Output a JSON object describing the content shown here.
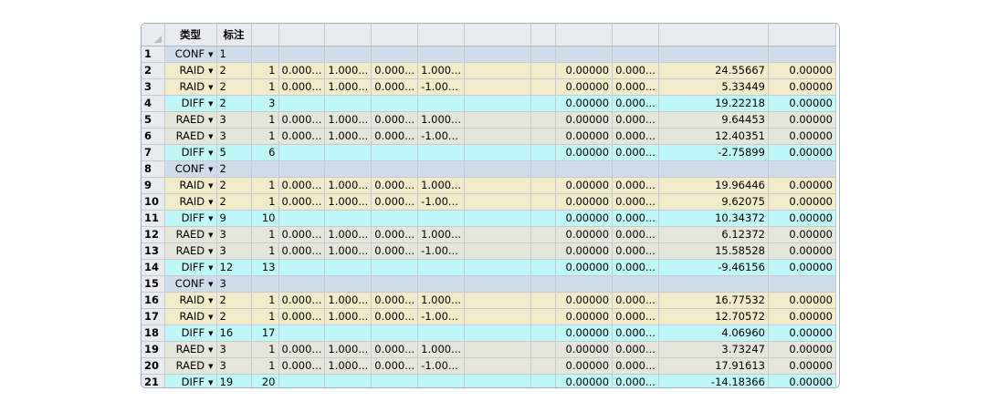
{
  "headers": [
    "",
    "类型",
    "标注",
    "",
    "",
    "",
    "",
    "",
    "",
    "",
    "",
    "",
    "",
    ""
  ],
  "rows": [
    {
      "n": "1",
      "kind": "conf",
      "type": "CONF",
      "mark": "1",
      "c3": "",
      "c4": "",
      "c5": "",
      "c6": "",
      "c7": "",
      "c10": "",
      "c11": "",
      "c12": "",
      "c13": ""
    },
    {
      "n": "2",
      "kind": "raid",
      "type": "RAID",
      "mark": "2",
      "c3": "1",
      "c4": "0.000...",
      "c5": "1.000...",
      "c6": "0.000...",
      "c7": "1.000...",
      "c10": "0.00000",
      "c11": "0.000...",
      "c12": "24.55667",
      "c13": "0.00000"
    },
    {
      "n": "3",
      "kind": "raid",
      "type": "RAID",
      "mark": "2",
      "c3": "1",
      "c4": "0.000...",
      "c5": "1.000...",
      "c6": "0.000...",
      "c7": "-1.00...",
      "c10": "0.00000",
      "c11": "0.000...",
      "c12": "5.33449",
      "c13": "0.00000"
    },
    {
      "n": "4",
      "kind": "diff",
      "type": "DIFF",
      "mark": "2",
      "c3": "3",
      "c4": "",
      "c5": "",
      "c6": "",
      "c7": "",
      "c10": "0.00000",
      "c11": "0.000...",
      "c12": "19.22218",
      "c13": "0.00000"
    },
    {
      "n": "5",
      "kind": "raed",
      "type": "RAED",
      "mark": "3",
      "c3": "1",
      "c4": "0.000...",
      "c5": "1.000...",
      "c6": "0.000...",
      "c7": "1.000...",
      "c10": "0.00000",
      "c11": "0.000...",
      "c12": "9.64453",
      "c13": "0.00000"
    },
    {
      "n": "6",
      "kind": "raed",
      "type": "RAED",
      "mark": "3",
      "c3": "1",
      "c4": "0.000...",
      "c5": "1.000...",
      "c6": "0.000...",
      "c7": "-1.00...",
      "c10": "0.00000",
      "c11": "0.000...",
      "c12": "12.40351",
      "c13": "0.00000"
    },
    {
      "n": "7",
      "kind": "diff",
      "type": "DIFF",
      "mark": "5",
      "c3": "6",
      "c4": "",
      "c5": "",
      "c6": "",
      "c7": "",
      "c10": "0.00000",
      "c11": "0.000...",
      "c12": "-2.75899",
      "c13": "0.00000"
    },
    {
      "n": "8",
      "kind": "conf",
      "type": "CONF",
      "mark": "2",
      "c3": "",
      "c4": "",
      "c5": "",
      "c6": "",
      "c7": "",
      "c10": "",
      "c11": "",
      "c12": "",
      "c13": ""
    },
    {
      "n": "9",
      "kind": "raid",
      "type": "RAID",
      "mark": "2",
      "c3": "1",
      "c4": "0.000...",
      "c5": "1.000...",
      "c6": "0.000...",
      "c7": "1.000...",
      "c10": "0.00000",
      "c11": "0.000...",
      "c12": "19.96446",
      "c13": "0.00000"
    },
    {
      "n": "10",
      "kind": "raid",
      "type": "RAID",
      "mark": "2",
      "c3": "1",
      "c4": "0.000...",
      "c5": "1.000...",
      "c6": "0.000...",
      "c7": "-1.00...",
      "c10": "0.00000",
      "c11": "0.000...",
      "c12": "9.62075",
      "c13": "0.00000"
    },
    {
      "n": "11",
      "kind": "diff",
      "type": "DIFF",
      "mark": "9",
      "c3": "10",
      "c4": "",
      "c5": "",
      "c6": "",
      "c7": "",
      "c10": "0.00000",
      "c11": "0.000...",
      "c12": "10.34372",
      "c13": "0.00000"
    },
    {
      "n": "12",
      "kind": "raed",
      "type": "RAED",
      "mark": "3",
      "c3": "1",
      "c4": "0.000...",
      "c5": "1.000...",
      "c6": "0.000...",
      "c7": "1.000...",
      "c10": "0.00000",
      "c11": "0.000...",
      "c12": "6.12372",
      "c13": "0.00000"
    },
    {
      "n": "13",
      "kind": "raed",
      "type": "RAED",
      "mark": "3",
      "c3": "1",
      "c4": "0.000...",
      "c5": "1.000...",
      "c6": "0.000...",
      "c7": "-1.00...",
      "c10": "0.00000",
      "c11": "0.000...",
      "c12": "15.58528",
      "c13": "0.00000"
    },
    {
      "n": "14",
      "kind": "diff",
      "type": "DIFF",
      "mark": "12",
      "c3": "13",
      "c4": "",
      "c5": "",
      "c6": "",
      "c7": "",
      "c10": "0.00000",
      "c11": "0.000...",
      "c12": "-9.46156",
      "c13": "0.00000"
    },
    {
      "n": "15",
      "kind": "conf",
      "type": "CONF",
      "mark": "3",
      "c3": "",
      "c4": "",
      "c5": "",
      "c6": "",
      "c7": "",
      "c10": "",
      "c11": "",
      "c12": "",
      "c13": ""
    },
    {
      "n": "16",
      "kind": "raid",
      "type": "RAID",
      "mark": "2",
      "c3": "1",
      "c4": "0.000...",
      "c5": "1.000...",
      "c6": "0.000...",
      "c7": "1.000...",
      "c10": "0.00000",
      "c11": "0.000...",
      "c12": "16.77532",
      "c13": "0.00000"
    },
    {
      "n": "17",
      "kind": "raid",
      "type": "RAID",
      "mark": "2",
      "c3": "1",
      "c4": "0.000...",
      "c5": "1.000...",
      "c6": "0.000...",
      "c7": "-1.00...",
      "c10": "0.00000",
      "c11": "0.000...",
      "c12": "12.70572",
      "c13": "0.00000"
    },
    {
      "n": "18",
      "kind": "diff",
      "type": "DIFF",
      "mark": "16",
      "c3": "17",
      "c4": "",
      "c5": "",
      "c6": "",
      "c7": "",
      "c10": "0.00000",
      "c11": "0.000...",
      "c12": "4.06960",
      "c13": "0.00000"
    },
    {
      "n": "19",
      "kind": "raed",
      "type": "RAED",
      "mark": "3",
      "c3": "1",
      "c4": "0.000...",
      "c5": "1.000...",
      "c6": "0.000...",
      "c7": "1.000...",
      "c10": "0.00000",
      "c11": "0.000...",
      "c12": "3.73247",
      "c13": "0.00000"
    },
    {
      "n": "20",
      "kind": "raed",
      "type": "RAED",
      "mark": "3",
      "c3": "1",
      "c4": "0.000...",
      "c5": "1.000...",
      "c6": "0.000...",
      "c7": "-1.00...",
      "c10": "0.00000",
      "c11": "0.000...",
      "c12": "17.91613",
      "c13": "0.00000"
    },
    {
      "n": "21",
      "kind": "diff",
      "type": "DIFF",
      "mark": "19",
      "c3": "20",
      "c4": "",
      "c5": "",
      "c6": "",
      "c7": "",
      "c10": "0.00000",
      "c11": "0.000...",
      "c12": "-14.18366",
      "c13": "0.00000"
    }
  ],
  "colors": {
    "conf": "#cfdce9",
    "raid": "#f2ebc9",
    "raed": "#e5e6da",
    "diff": "#bff7f8",
    "header": "#e9ebee"
  },
  "icons": {
    "dropdown": "caret-down-icon",
    "scroll_up": "chevron-up-icon",
    "scroll_down": "chevron-down-icon",
    "corner": "select-all-triangle-icon"
  }
}
